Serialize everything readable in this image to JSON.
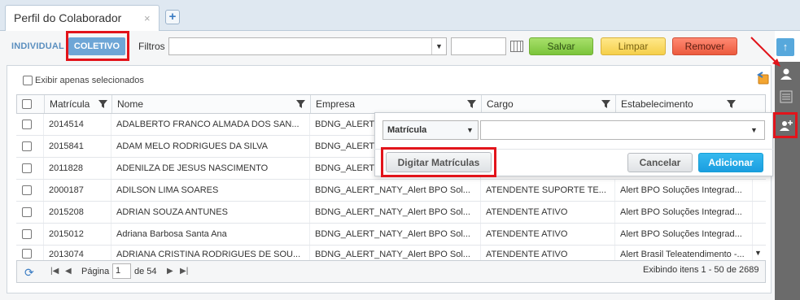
{
  "tab": {
    "title": "Perfil do Colaborador",
    "close": "×",
    "add": "+"
  },
  "toolbar": {
    "mode_individual": "INDIVIDUAL",
    "mode_coletivo": "COLETIVO",
    "filters_label": "Filtros",
    "save": "Salvar",
    "clear": "Limpar",
    "remove": "Remover"
  },
  "selection": {
    "only_selected_label": "Exibir apenas selecionados"
  },
  "grid": {
    "columns": [
      "Matrícula",
      "Nome",
      "Empresa",
      "Cargo",
      "Estabelecimento"
    ],
    "rows": [
      {
        "matricula": "2014514",
        "nome": "ADALBERTO FRANCO ALMADA DOS SAN...",
        "empresa": "BDNG_ALERT",
        "cargo": "",
        "estab": ""
      },
      {
        "matricula": "2015841",
        "nome": "ADAM MELO RODRIGUES DA SILVA",
        "empresa": "BDNG_ALERT",
        "cargo": "",
        "estab": ""
      },
      {
        "matricula": "2011828",
        "nome": "ADENILZA DE JESUS NASCIMENTO",
        "empresa": "BDNG_ALERT",
        "cargo": "",
        "estab": ""
      },
      {
        "matricula": "2000187",
        "nome": "ADILSON LIMA SOARES",
        "empresa": "BDNG_ALERT_NATY_Alert BPO Sol...",
        "cargo": "ATENDENTE SUPORTE TE...",
        "estab": "Alert BPO Soluções Integrad..."
      },
      {
        "matricula": "2015208",
        "nome": "ADRIAN SOUZA ANTUNES",
        "empresa": "BDNG_ALERT_NATY_Alert BPO Sol...",
        "cargo": "ATENDENTE ATIVO",
        "estab": "Alert BPO Soluções Integrad..."
      },
      {
        "matricula": "2015012",
        "nome": "Adriana Barbosa Santa Ana",
        "empresa": "BDNG_ALERT_NATY_Alert BPO Sol...",
        "cargo": "ATENDENTE ATIVO",
        "estab": "Alert BPO Soluções Integrad..."
      },
      {
        "matricula": "2013074",
        "nome": "ADRIANA CRISTINA RODRIGUES DE SOU...",
        "empresa": "BDNG_ALERT_NATY_Alert BPO Sol...",
        "cargo": "ATENDENTE ATIVO",
        "estab": "Alert Brasil Teleatendimento -..."
      }
    ]
  },
  "pager": {
    "page_label": "Página",
    "page_value": "1",
    "total": "de 54",
    "info": "Exibindo itens 1 - 50 de 2689"
  },
  "popup": {
    "field_select": "Matrícula",
    "enter_ids": "Digitar Matrículas",
    "cancel": "Cancelar",
    "add": "Adicionar"
  },
  "icons": {
    "up": "arrow-up-icon",
    "person": "person-icon",
    "list": "list-icon",
    "add_person": "add-person-icon",
    "undo": "undo-icon",
    "refresh": "refresh-icon"
  },
  "colors": {
    "highlight": "#e2141b",
    "accent": "#57a8dc",
    "save": "#7bc43b",
    "clear": "#f5cf4a",
    "remove": "#ec5a3e",
    "add": "#1b9ee0"
  }
}
